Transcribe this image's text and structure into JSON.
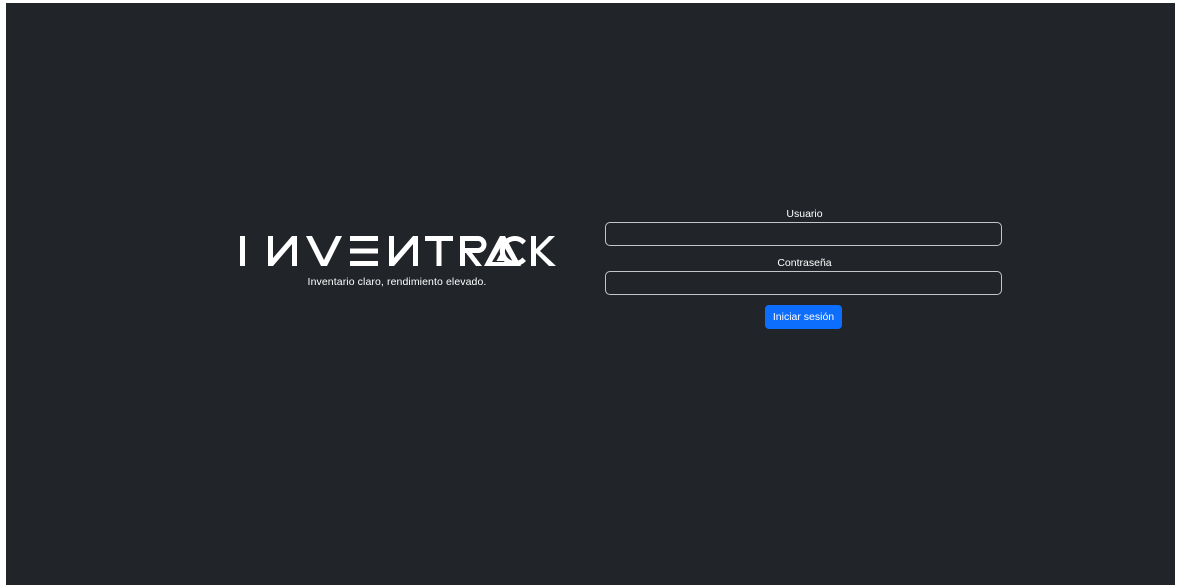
{
  "brand": {
    "logo_text": "INVENTRACK",
    "tagline": "Inventario claro, rendimiento elevado."
  },
  "form": {
    "username_label": "Usuario",
    "username_value": "",
    "password_label": "Contraseña",
    "password_value": "",
    "submit_label": "Iniciar sesión"
  },
  "colors": {
    "background": "#212429",
    "text": "#ffffff",
    "input_border": "#c3c5c8",
    "button": "#0d6efd"
  }
}
